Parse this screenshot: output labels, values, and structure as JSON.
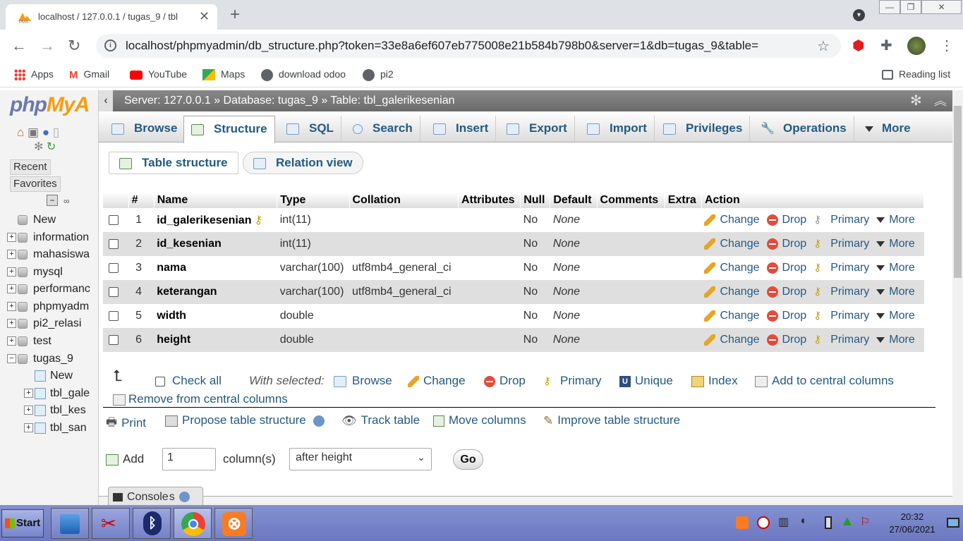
{
  "browser": {
    "tab_title": "localhost / 127.0.0.1 / tugas_9 / tbl",
    "url": "localhost/phpmyadmin/db_structure.php?token=33e8a6ef607eb775008e21b584b798b0&server=1&db=tugas_9&table=",
    "bookmarks": [
      "Apps",
      "Gmail",
      "YouTube",
      "Maps",
      "download odoo",
      "pi2"
    ],
    "reading_list": "Reading list"
  },
  "pma_nav": {
    "logo_a": "php",
    "logo_b": "MyA",
    "recent": "Recent",
    "favorites": "Favorites",
    "tree": [
      {
        "label": "New",
        "level": 0
      },
      {
        "label": "information",
        "level": 0
      },
      {
        "label": "mahasiswa",
        "level": 0
      },
      {
        "label": "mysql",
        "level": 0
      },
      {
        "label": "performanc",
        "level": 0
      },
      {
        "label": "phpmyadm",
        "level": 0
      },
      {
        "label": "pi2_relasi",
        "level": 0
      },
      {
        "label": "test",
        "level": 0
      },
      {
        "label": "tugas_9",
        "level": 0
      },
      {
        "label": "New",
        "level": 1
      },
      {
        "label": "tbl_gale",
        "level": 1
      },
      {
        "label": "tbl_kes",
        "level": 1
      },
      {
        "label": "tbl_san",
        "level": 1
      }
    ]
  },
  "breadcrumb": {
    "server": "Server: 127.0.0.1",
    "database": "Database: tugas_9",
    "table": "Table: tbl_galerikesenian"
  },
  "tabs": [
    "Browse",
    "Structure",
    "SQL",
    "Search",
    "Insert",
    "Export",
    "Import",
    "Privileges",
    "Operations",
    "More"
  ],
  "subtabs": [
    "Table structure",
    "Relation view"
  ],
  "columns": [
    "#",
    "Name",
    "Type",
    "Collation",
    "Attributes",
    "Null",
    "Default",
    "Comments",
    "Extra",
    "Action"
  ],
  "rows": [
    {
      "num": "1",
      "name": "id_galerikesenian",
      "type": "int(11)",
      "collation": "",
      "null": "No",
      "default": "None"
    },
    {
      "num": "2",
      "name": "id_kesenian",
      "type": "int(11)",
      "collation": "",
      "null": "No",
      "default": "None"
    },
    {
      "num": "3",
      "name": "nama",
      "type": "varchar(100)",
      "collation": "utf8mb4_general_ci",
      "null": "No",
      "default": "None"
    },
    {
      "num": "4",
      "name": "keterangan",
      "type": "varchar(100)",
      "collation": "utf8mb4_general_ci",
      "null": "No",
      "default": "None"
    },
    {
      "num": "5",
      "name": "width",
      "type": "double",
      "collation": "",
      "null": "No",
      "default": "None"
    },
    {
      "num": "6",
      "name": "height",
      "type": "double",
      "collation": "",
      "null": "No",
      "default": "None"
    }
  ],
  "row_actions": {
    "change": "Change",
    "drop": "Drop",
    "primary": "Primary",
    "more": "More"
  },
  "with_selected": {
    "check_all": "Check all",
    "label": "With selected:",
    "browse": "Browse",
    "change": "Change",
    "drop": "Drop",
    "primary": "Primary",
    "unique": "Unique",
    "index": "Index",
    "add_central": "Add to central columns",
    "remove_central": "Remove from central columns"
  },
  "tools": {
    "print": "Print",
    "propose": "Propose table structure",
    "track": "Track table",
    "move": "Move columns",
    "improve": "Improve table structure"
  },
  "add_column": {
    "label": "Add",
    "value": "1",
    "unit": "column(s)",
    "position": "after height",
    "go": "Go"
  },
  "console": {
    "label": "Console",
    "behind": "s"
  },
  "taskbar": {
    "start": "Start",
    "time": "20:32",
    "date": "27/06/2021"
  }
}
